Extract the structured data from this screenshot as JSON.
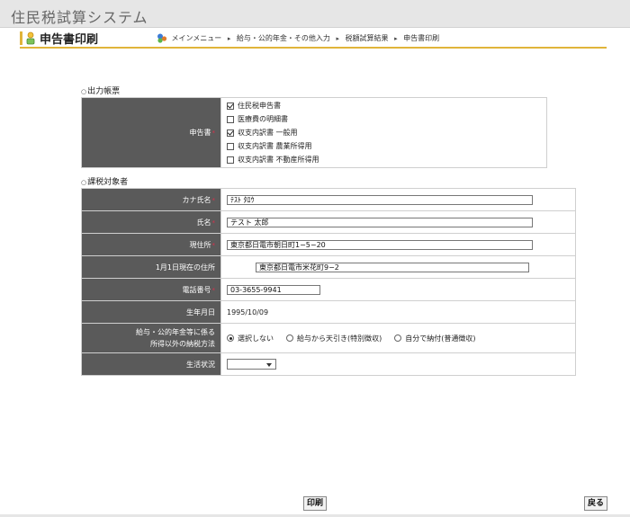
{
  "app": {
    "title": "住民税試算システム"
  },
  "page": {
    "title": "申告書印刷",
    "breadcrumb": [
      "メインメニュー",
      "給与・公的年金・その他入力",
      "税額試算結果",
      "申告書印刷"
    ]
  },
  "sections": {
    "output_forms": "出力帳票",
    "taxpayer": "課税対象者"
  },
  "output_forms": {
    "label": "申告書",
    "options": [
      {
        "label": "住民税申告書",
        "checked": true
      },
      {
        "label": "医療費の明細書",
        "checked": false
      },
      {
        "label": "収支内訳書 一般用",
        "checked": true
      },
      {
        "label": "収支内訳書 農業所得用",
        "checked": false
      },
      {
        "label": "収支内訳書 不動産所得用",
        "checked": false
      }
    ]
  },
  "taxpayer": {
    "kana_label": "カナ氏名",
    "kana_value": "ﾃｽﾄ ﾀﾛｳ",
    "name_label": "氏名",
    "name_value": "テスト 太郎",
    "address_label": "現住所",
    "address_value": "東京都日電市朝日町1−5−20",
    "jan1_label": "1月1日現在の住所",
    "jan1_value": "東京都日電市米花町9−2",
    "phone_label": "電話番号",
    "phone_value": "03-3655-9941",
    "birth_label": "生年月日",
    "birth_value": "1995/10/09",
    "pay_method_label_1": "給与・公的年金等に係る",
    "pay_method_label_2": "所得以外の納税方法",
    "pay_method_options": [
      "選択しない",
      "給与から天引き(特別徴収)",
      "自分で納付(普通徴収)"
    ],
    "pay_method_selected": 0,
    "living_label": "生活状況",
    "living_value": ""
  },
  "buttons": {
    "print": "印刷",
    "back": "戻る"
  },
  "colors": {
    "label_bg": "#5a5a5a",
    "accent": "#e0b43a",
    "required": "#d8314c"
  }
}
